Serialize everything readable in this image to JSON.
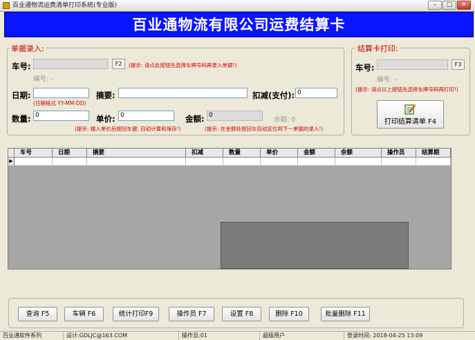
{
  "window": {
    "title": "百业通物流运费清单打印系统(专业版)",
    "minimize_label": "–",
    "restore_label": "□",
    "close_label": "✕"
  },
  "banner": {
    "title": "百业通物流有限公司运费结算卡"
  },
  "entry": {
    "legend": "单据录入:",
    "car_label": "车号:",
    "car_value": "",
    "f2_label": "F2",
    "car_hint": "(提示: 请点此按钮先选择车牌号码再录入单据!)",
    "serial_label": "编号: -",
    "date_label": "日期:",
    "date_value": "",
    "date_format_hint": "(日期格式 YY-MM-DD)",
    "summary_label": "摘要:",
    "summary_value": "",
    "deduct_label": "扣减(支付):",
    "deduct_value": "0",
    "qty_label": "数量:",
    "qty_value": "0",
    "price_label": "单价:",
    "price_value": "0",
    "amount_label": "金额:",
    "amount_value": "0",
    "balance_label": "余额: 0",
    "price_hint": "(提示: 输入单价后按回车键, 自动计算和保存!)",
    "amount_hint": "(提示: 在金额处按回车自动定位到下一单据的录入!)"
  },
  "card_print": {
    "legend": "结算卡打印:",
    "car_label": "车号:",
    "car_value": "",
    "f3_label": "F3",
    "serial_label": "编号: -",
    "hint": "(提示: 请点以上按钮先选择车牌号码再打印!)",
    "print_button_label": "打印结算清单 F4",
    "print_icon": "pencil-document-icon"
  },
  "grid": {
    "columns": [
      "车号",
      "日期",
      "摘要",
      "扣减",
      "数量",
      "单价",
      "金额",
      "余额",
      "操作员",
      "结算期"
    ],
    "row_marker": "▶"
  },
  "toolbar": {
    "buttons": [
      "查询 F5",
      "车辆 F6",
      "统计打印F9",
      "操作员 F7",
      "设置 F8",
      "删除 F10",
      "批量删除 F11"
    ]
  },
  "status": {
    "company": "百业通软件系列",
    "designer": "设计:GDLJC@163.COM",
    "operator": "操作员:01",
    "user": "超级用户",
    "login_time": "登录时间: 2018-04-25  13:09"
  }
}
